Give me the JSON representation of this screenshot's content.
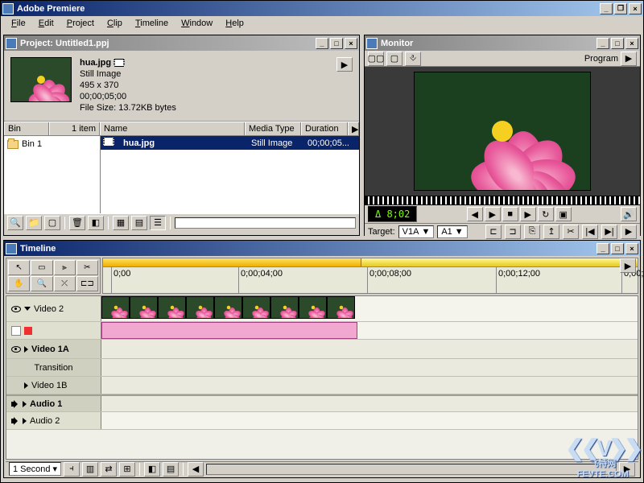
{
  "app": {
    "title": "Adobe Premiere",
    "menu": [
      "File",
      "Edit",
      "Project",
      "Clip",
      "Timeline",
      "Window",
      "Help"
    ]
  },
  "project": {
    "title": "Project: Untitled1.ppj",
    "clip": {
      "name": "hua.jpg",
      "type": "Still Image",
      "dims": "495 x 370",
      "duration": "00;00;05;00",
      "size": "File Size: 13.72KB bytes"
    },
    "headers": {
      "bin": "Bin",
      "count": "1 item",
      "name": "Name",
      "media": "Media Type",
      "dur": "Duration"
    },
    "bin": "Bin 1",
    "row": {
      "name": "hua.jpg",
      "media": "Still Image",
      "dur": "00;00;05..."
    }
  },
  "monitor": {
    "title": "Monitor",
    "program": "Program",
    "timecode": "Δ 8;02",
    "target": "Target:",
    "v": "V1A",
    "a": "A1"
  },
  "timeline": {
    "title": "Timeline",
    "ticks": [
      "0;00",
      "0;00;04;00",
      "0;00;08;00",
      "0;00;12;00",
      "0;00;"
    ],
    "tracks": {
      "v2": "Video 2",
      "v1a": "Video 1A",
      "trans": "Transition",
      "v1b": "Video 1B",
      "a1": "Audio 1",
      "a2": "Audio 2"
    },
    "zoom": "1 Second"
  },
  "watermark": {
    "cn": "飞特网",
    "en": "FEVTE.COM"
  }
}
